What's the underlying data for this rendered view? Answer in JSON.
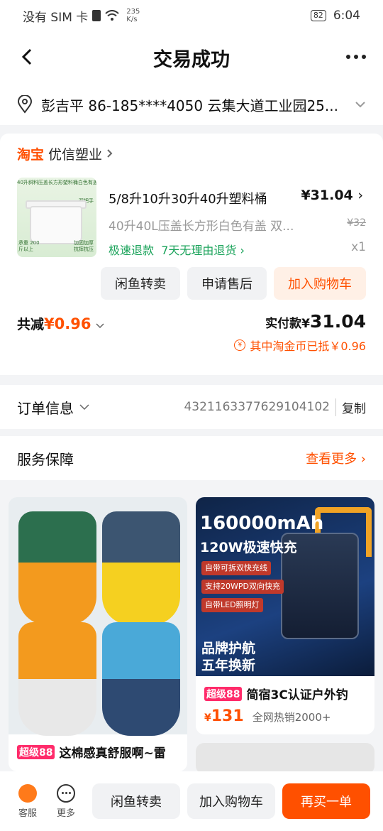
{
  "status_bar": {
    "carrier": "没有 SIM 卡",
    "speed_value": "235",
    "speed_unit": "K/s",
    "battery": "82",
    "time": "6:04"
  },
  "header": {
    "title": "交易成功"
  },
  "address": {
    "text": "彭吉平 86-185****4050 云集大道工业园25..."
  },
  "shop": {
    "platform": "淘宝",
    "name": "优信塑业"
  },
  "item": {
    "image_banner": "40升斜料压盖长方形塑料桶白色有盖",
    "image_tag_top": "双把手",
    "image_tag_left": "承重 200斤以上",
    "image_tag_right": "加固加厚 抗摔抗压",
    "name": "5/8升10升30升40升塑料桶",
    "price": "¥31.04",
    "spec": "40升40L压盖长方形白色有盖 双...",
    "original_price": "¥32",
    "refund_fast": "极速退款",
    "refund_7day": "7天无理由退货",
    "quantity": "x1",
    "actions": [
      "闲鱼转卖",
      "申请售后",
      "加入购物车"
    ]
  },
  "summary": {
    "discount_label": "共减",
    "discount_value": "¥0.96",
    "paid_label": "实付款",
    "paid_currency": "¥",
    "paid_value": "31.04",
    "coins_text": "其中淘金币已抵￥0.96"
  },
  "order_info": {
    "label": "订单信息",
    "order_no": "4321163377629104102",
    "copy_label": "复制"
  },
  "service": {
    "label": "服务保障",
    "see_more": "查看更多"
  },
  "feed": {
    "left": {
      "badge": "超级88",
      "title": "这棉感真舒服啊~雷"
    },
    "right": {
      "image_title": "160000mAh",
      "image_sub": "120W极速快充",
      "image_tags": [
        "自带可拆双快充线",
        "支持20WPD双向快充",
        "自带LED照明灯"
      ],
      "image_bottom1": "品牌护航",
      "image_bottom2": "五年换新",
      "badge": "超级88",
      "title": "简宿3C认证户外钓",
      "price_symbol": "¥",
      "price": "131",
      "hot": "全网热销2000+"
    }
  },
  "bottom_bar": {
    "cs_label": "客服",
    "more_label": "更多",
    "resell": "闲鱼转卖",
    "add_cart": "加入购物车",
    "buy_again": "再买一单"
  },
  "colors": {
    "accent": "#ff5000",
    "green": "#1aa35a"
  }
}
